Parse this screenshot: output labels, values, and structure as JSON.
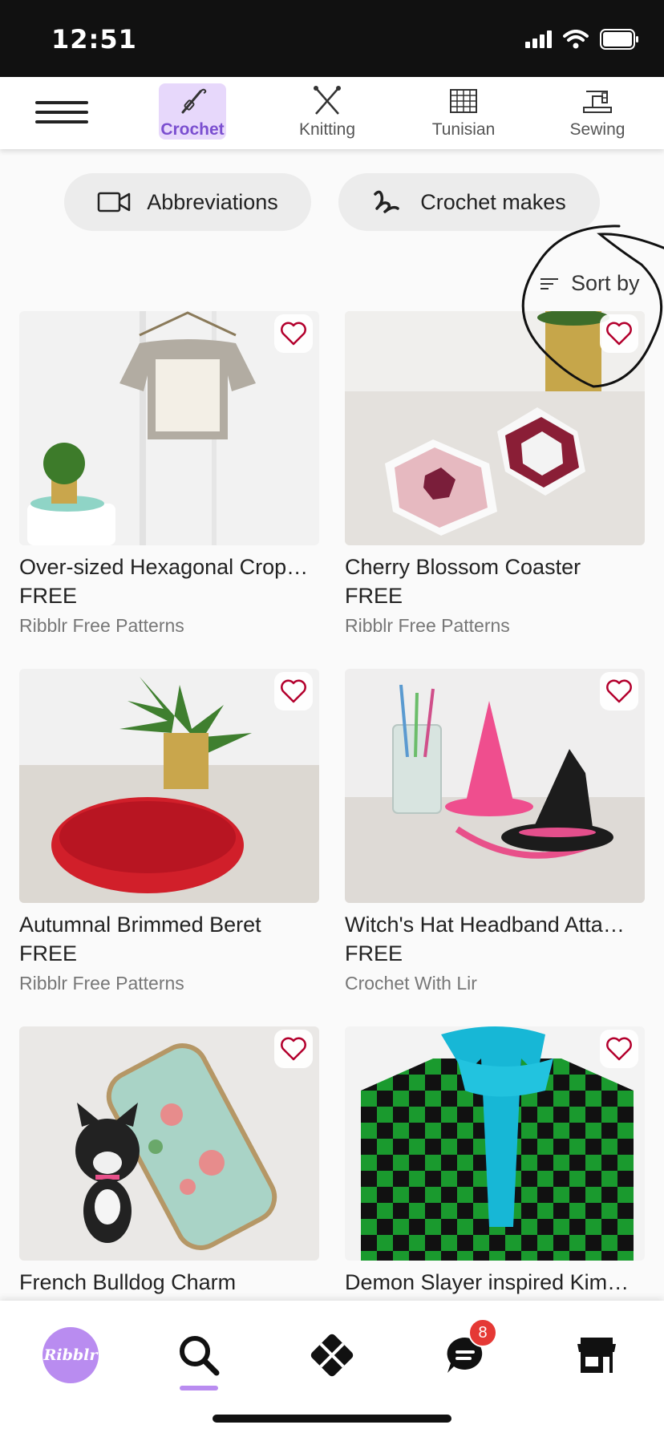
{
  "status_bar": {
    "time": "12:51"
  },
  "categories": [
    {
      "label": "Crochet",
      "icon": "crochet-hook-icon",
      "active": true
    },
    {
      "label": "Knitting",
      "icon": "knitting-needles-icon",
      "active": false
    },
    {
      "label": "Tunisian",
      "icon": "tunisian-grid-icon",
      "active": false
    },
    {
      "label": "Sewing",
      "icon": "sewing-machine-icon",
      "active": false
    }
  ],
  "pills": [
    {
      "label": "Abbreviations",
      "icon": "video-camera-icon"
    },
    {
      "label": "Crochet makes",
      "icon": "squiggle-icon"
    }
  ],
  "sort": {
    "label": "Sort by",
    "icon": "sort-icon"
  },
  "products": [
    {
      "title": "Over-sized Hexagonal Crop…",
      "price": "FREE",
      "author": "Ribblr Free Patterns"
    },
    {
      "title": "Cherry Blossom Coaster",
      "price": "FREE",
      "author": "Ribblr Free Patterns"
    },
    {
      "title": "Autumnal Brimmed Beret",
      "price": "FREE",
      "author": "Ribblr Free Patterns"
    },
    {
      "title": "Witch's Hat Headband Atta…",
      "price": "FREE",
      "author": "Crochet With Lir"
    },
    {
      "title": "French Bulldog Charm",
      "price": "",
      "author": ""
    },
    {
      "title": "Demon Slayer inspired Kim…",
      "price": "",
      "author": ""
    }
  ],
  "bottom_nav": {
    "logo_text": "Ribblr",
    "items": [
      "ribblr-logo",
      "search-icon",
      "patterns-icon",
      "messages-icon",
      "shop-icon"
    ],
    "messages_badge": "8"
  },
  "colors": {
    "accent": "#b98cf0",
    "active_tab_bg": "#e7d8fb",
    "heart": "#b3002d"
  }
}
